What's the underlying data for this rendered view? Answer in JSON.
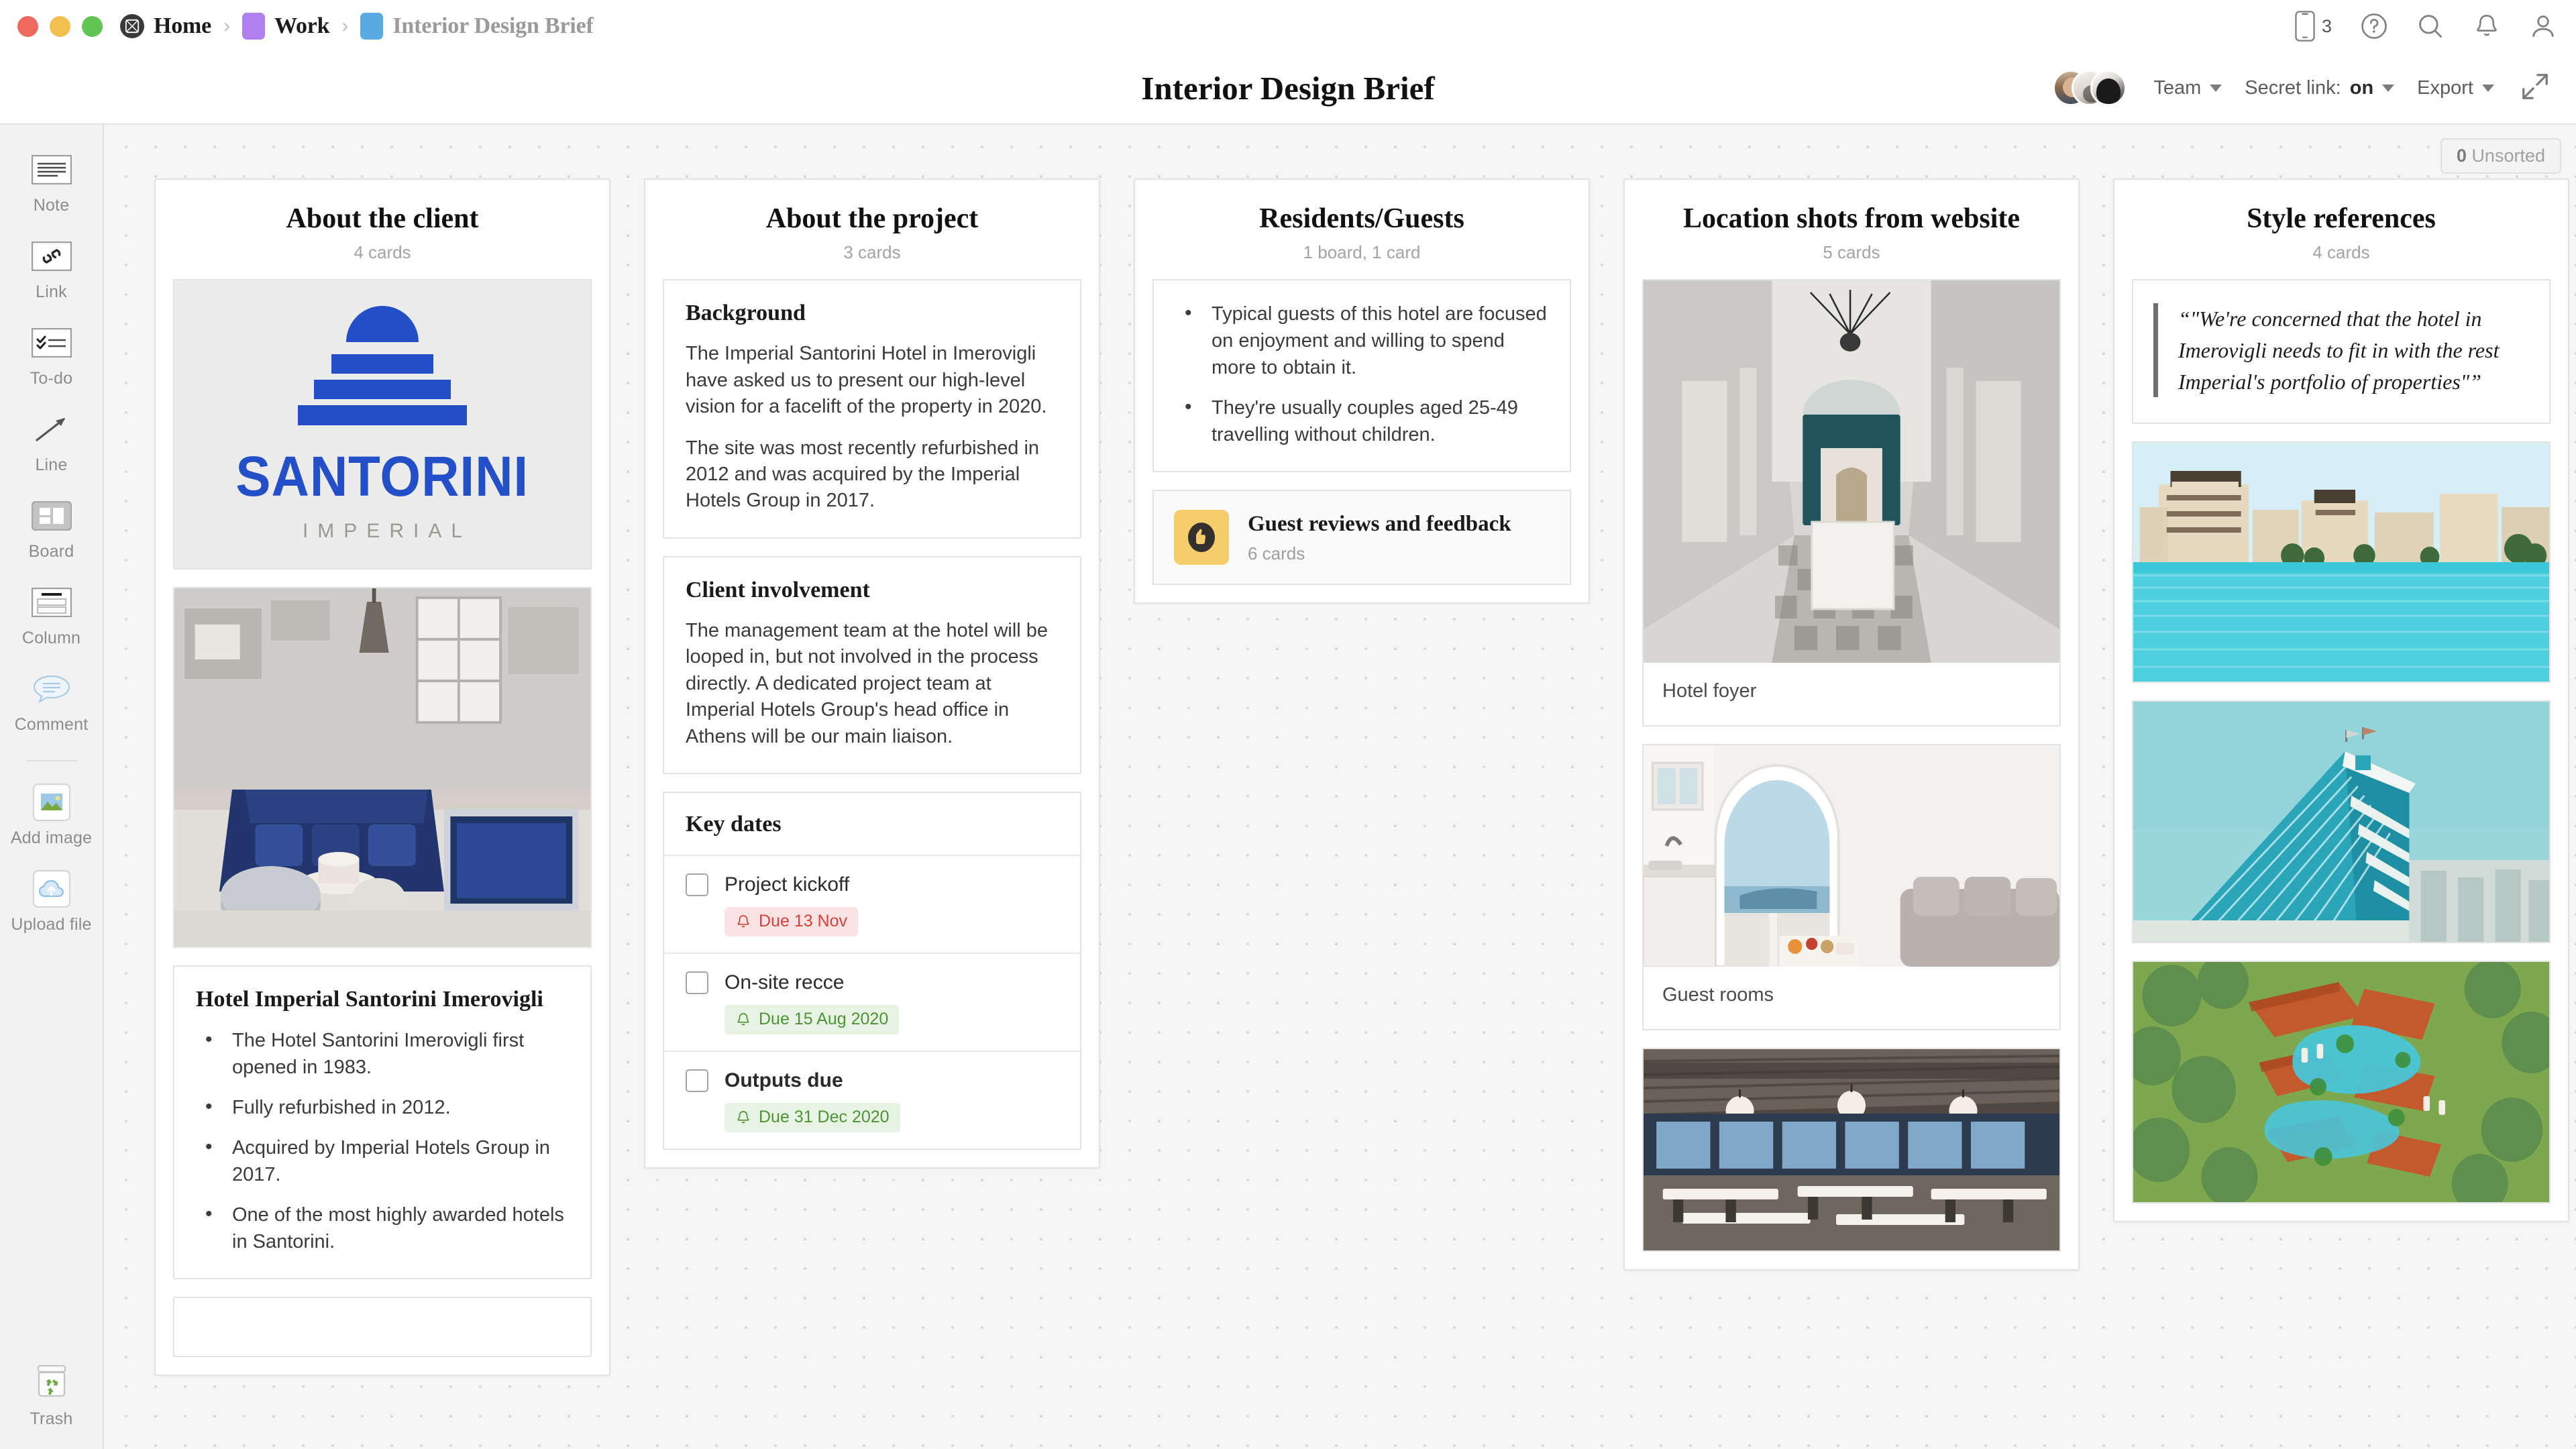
{
  "titlebar": {
    "breadcrumbs": [
      {
        "label": "Home",
        "icon": "milanote-logo-icon",
        "type": "home"
      },
      {
        "label": "Work",
        "icon": "purple-square-icon",
        "type": "folder"
      },
      {
        "label": "Interior Design Brief",
        "icon": "blue-square-icon",
        "type": "board"
      }
    ],
    "separator": "›",
    "icons": [
      {
        "name": "mobile-icon",
        "count": "3"
      },
      {
        "name": "help-icon"
      },
      {
        "name": "search-icon"
      },
      {
        "name": "notifications-icon"
      },
      {
        "name": "account-icon"
      }
    ]
  },
  "subheader": {
    "title": "Interior Design Brief",
    "team_label": "Team",
    "secret_link_label": "Secret link:",
    "secret_link_value": "on",
    "export_label": "Export",
    "expand_icon": "expand-icon"
  },
  "canvas": {
    "unsorted_count": "0",
    "unsorted_label": "Unsorted"
  },
  "sidebar": {
    "tools": [
      {
        "label": "Note",
        "icon": "note-icon"
      },
      {
        "label": "Link",
        "icon": "link-icon"
      },
      {
        "label": "To-do",
        "icon": "todo-icon"
      },
      {
        "label": "Line",
        "icon": "line-arrow-icon"
      },
      {
        "label": "Board",
        "icon": "board-icon"
      },
      {
        "label": "Column",
        "icon": "column-icon"
      },
      {
        "label": "Comment",
        "icon": "comment-icon"
      }
    ],
    "media_tools": [
      {
        "label": "Add image",
        "icon": "add-image-icon"
      },
      {
        "label": "Upload file",
        "icon": "upload-file-icon"
      }
    ],
    "trash": {
      "label": "Trash",
      "icon": "trash-icon"
    }
  },
  "columns": [
    {
      "title": "About the client",
      "subtitle": "4 cards",
      "logo": {
        "wordmark": "SANTORINI",
        "subtext": "IMPERIAL",
        "color": "#2350c8"
      },
      "photo_caption_alt": "blue sofa living room",
      "card": {
        "heading": "Hotel Imperial Santorini Imerovigli",
        "bullets": [
          "The Hotel Santorini Imerovigli first opened in 1983.",
          "Fully refurbished in 2012.",
          "Acquired by Imperial Hotels Group in 2017.",
          "One of the most highly awarded hotels in Santorini."
        ]
      }
    },
    {
      "title": "About the project",
      "subtitle": "3 cards",
      "background_card": {
        "heading": "Background",
        "paragraphs": [
          "The Imperial Santorini Hotel in Imerovigli have asked us to present our high-level vision for a facelift of the property in 2020.",
          "The site was most recently refurbished in 2012 and was acquired by the Imperial Hotels Group in 2017."
        ]
      },
      "involvement_card": {
        "heading": "Client involvement",
        "paragraphs": [
          "The management team at the hotel will be looped in, but not involved in the process directly. A dedicated project team at Imperial Hotels Group's head office in Athens will be our main liaison."
        ]
      },
      "key_dates_card": {
        "heading": "Key dates",
        "items": [
          {
            "label": "Project kickoff",
            "due": "Due 13 Nov",
            "status": "overdue",
            "bold": false,
            "checked": false
          },
          {
            "label": "On-site recce",
            "due": "Due 15 Aug 2020",
            "status": "upcoming",
            "bold": false,
            "checked": false
          },
          {
            "label": "Outputs due",
            "due": "Due 31 Dec 2020",
            "status": "upcoming",
            "bold": true,
            "checked": false
          }
        ]
      }
    },
    {
      "title": "Residents/Guests",
      "subtitle": "1 board, 1 card",
      "guest_card": {
        "bullets": [
          "Typical guests of this hotel are focused on enjoyment and willing to spend more to obtain it.",
          "They're usually couples aged 25-49 travelling without children."
        ]
      },
      "board_tile": {
        "name": "Guest reviews and feedback",
        "count": "6 cards",
        "thumb_color": "#f6cd6b",
        "thumb_icon": "thumbs-up-icon"
      }
    },
    {
      "title": "Location shots from website",
      "subtitle": "5 cards",
      "photos": [
        {
          "caption": "Hotel foyer",
          "alt": "white corridor with chandelier"
        },
        {
          "caption": "Guest rooms",
          "alt": "white guest room with sea view arch"
        },
        {
          "caption": "",
          "alt": "restaurant dining hall"
        }
      ]
    },
    {
      "title": "Style references",
      "subtitle": "4 cards",
      "quote": "“\"We're concerned that the hotel in Imerovigli needs to fit in with the rest Imperial's portfolio of properties\"”",
      "photos": [
        {
          "alt": "resort buildings on turquoise lagoon"
        },
        {
          "alt": "sail-shaped hotel on teal sky"
        },
        {
          "alt": "aerial resort with orange roofs and pools"
        }
      ]
    }
  ],
  "colors": {
    "accent_blue": "#2350c8",
    "overdue_red": "#d1433f",
    "upcoming_green": "#4f9338",
    "board_yellow": "#f6cd6b",
    "crumb_purple": "#b07ff0",
    "crumb_blue": "#5aabe4"
  }
}
